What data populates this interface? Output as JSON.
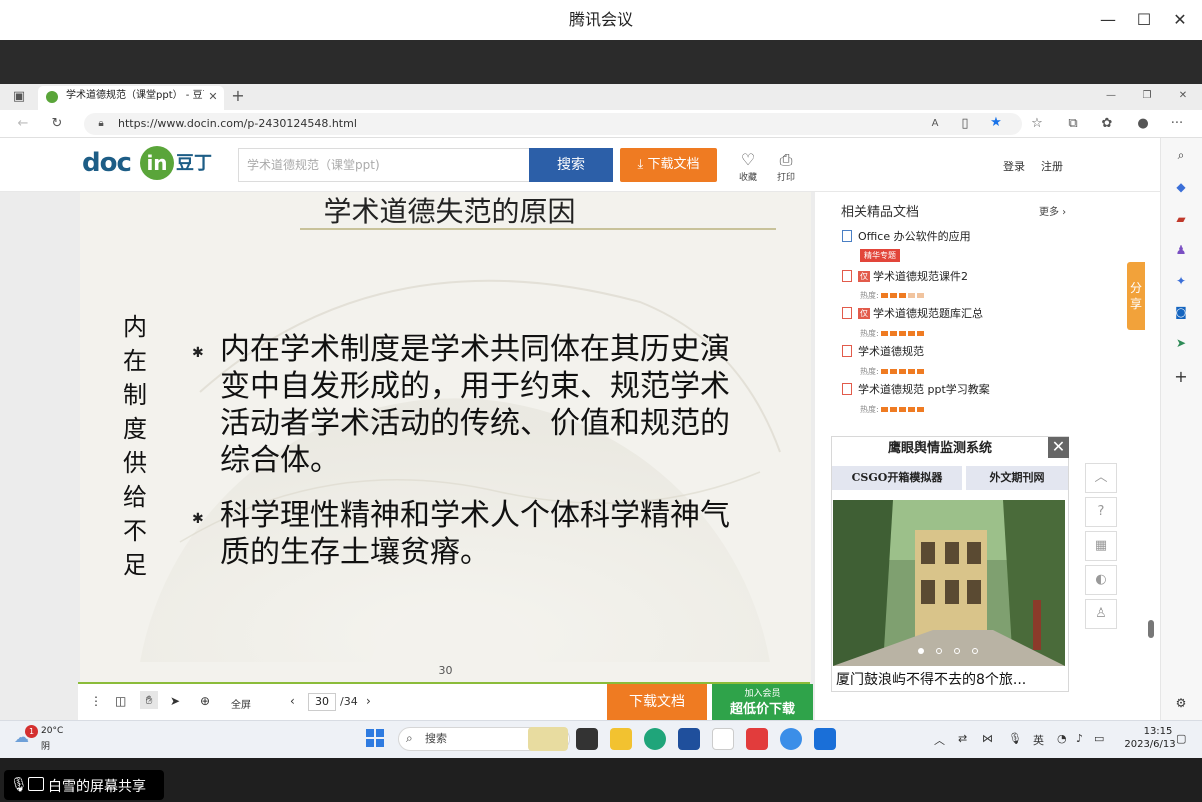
{
  "meeting": {
    "title": "腾讯会议",
    "share_label": "白雪的屏幕共享"
  },
  "browser": {
    "tab_title": "学术道德规范（课堂ppt） - 豆丁网",
    "url": "https://www.docin.com/p-2430124548.html"
  },
  "docin": {
    "logo_doc": "doc",
    "logo_in": "in",
    "logo_ding": "豆丁",
    "search_placeholder": "学术道德规范（课堂ppt)",
    "search_label": "搜索",
    "download_label": "下载文档",
    "favorite_label": "收藏",
    "print_label": "打印",
    "login_label": "登录",
    "register_label": "注册"
  },
  "slide": {
    "title": "学术道德失范的原因",
    "side_heading": [
      "内",
      "在",
      "制",
      "度",
      "供",
      "给",
      "不",
      "足"
    ],
    "paragraphs": [
      [
        "内在学术制度是学术共同体在其历史演",
        "变中自发形成的，用于约束、规范学术",
        "活动者学术活动的传统、价值和规范的",
        "综合体。"
      ],
      [
        "科学理性精神和学术人个体科学精神气",
        "质的生存土壤贫瘠。"
      ]
    ],
    "page_number": "30"
  },
  "doc_toolbar": {
    "fullscreen_label": "全屏",
    "current_page": "30",
    "total_pages": "/34",
    "download_label": "下载文档",
    "vip_small": "加入会员",
    "vip_big": "超低价下载"
  },
  "sidebar": {
    "related_title": "相关精品文档",
    "more_label": "更多",
    "pro_badge": "精华专题",
    "heat_label": "热度:",
    "items": [
      {
        "title": "Office 办公软件的应用",
        "type": "doc",
        "tag": ""
      },
      {
        "title": "学术道德规范课件2",
        "type": "pdf",
        "tag": "仅"
      },
      {
        "title": "学术道德规范题库汇总",
        "type": "pdf",
        "tag": "仅"
      },
      {
        "title": "学术道德规范",
        "type": "doc",
        "tag": ""
      },
      {
        "title": "学术道德规范 ppt学习教案",
        "type": "doc",
        "tag": ""
      }
    ],
    "heat_levels": [
      3,
      5,
      5,
      5
    ],
    "share_tab": "分享"
  },
  "ad": {
    "header": "鹰眼舆情监测系统",
    "link_1": "CSGO开箱模拟器",
    "link_2": "外文期刊网",
    "caption": "厦门鼓浪屿不得不去的8个旅..."
  },
  "taskbar": {
    "weather_badge": "1",
    "weather_temp": "20°C",
    "weather_cond": "阴",
    "search_label": "搜索",
    "lang": "英",
    "time": "13:15",
    "date": "2023/6/13"
  },
  "colors": {
    "docin_blue": "#2c5fa8",
    "docin_orange": "#ef7b22",
    "vip_green": "#2fa34a"
  }
}
